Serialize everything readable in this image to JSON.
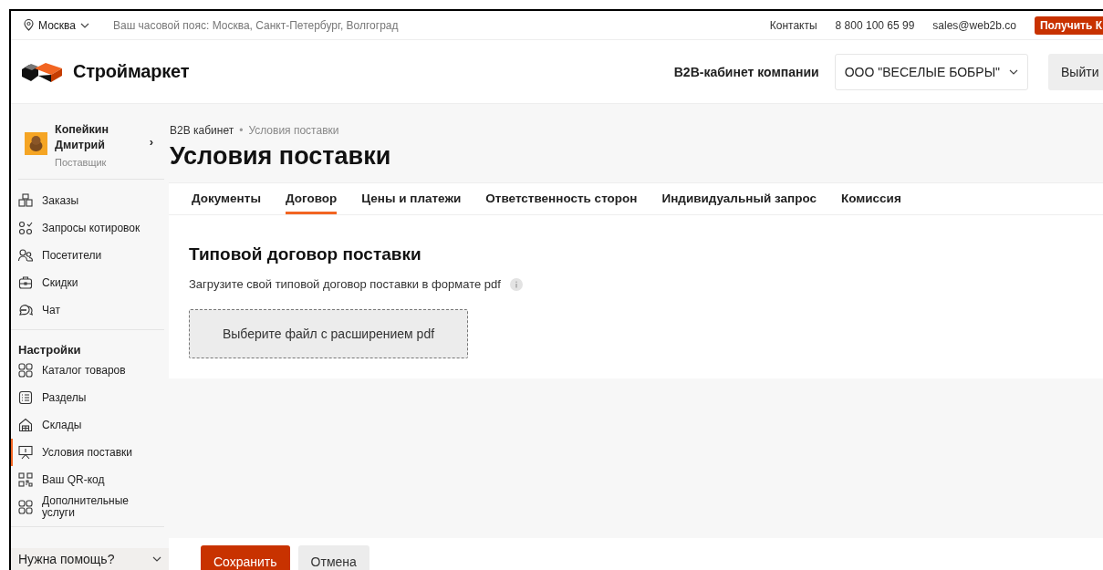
{
  "top_bar": {
    "city": "Москва",
    "timezone": "Ваш часовой пояс: Москва, Санкт-Петербург, Волгоград",
    "links": [
      "Контакты",
      "8 800 100 65 99",
      "sales@web2b.co"
    ],
    "cta": "Получить К"
  },
  "header": {
    "logo": "Строймаркет",
    "cabinet_label": "B2B-кабинет компании",
    "company": "ООО \"ВЕСЕЛЫЕ БОБРЫ\"",
    "logout": "Выйти"
  },
  "user": {
    "name": "Копейкин Дмитрий",
    "role": "Поставщик",
    "arrow": "›"
  },
  "sidebar": {
    "groups": [
      {
        "items": [
          {
            "label": "Заказы",
            "selected": false
          },
          {
            "label": "Запросы котировок",
            "selected": false
          },
          {
            "label": "Посетители",
            "selected": false
          },
          {
            "label": "Скидки",
            "selected": false
          },
          {
            "label": "Чат",
            "selected": false
          }
        ]
      },
      {
        "title": "Настройки",
        "items": [
          {
            "label": "Каталог товаров",
            "selected": false
          },
          {
            "label": "Разделы",
            "selected": false
          },
          {
            "label": "Склады",
            "selected": false
          },
          {
            "label": "Условия поставки",
            "selected": true
          },
          {
            "label": "Ваш QR-код",
            "selected": false
          },
          {
            "label": "Дополнительные услуги",
            "selected": false
          }
        ]
      }
    ],
    "help": "Нужна помощь?"
  },
  "breadcrumb": [
    "B2B кабинет",
    "Условия поставки"
  ],
  "breadcrumb_separator": "•",
  "title": "Условия поставки",
  "tabs": [
    {
      "label": "Документы",
      "selected": false
    },
    {
      "label": "Договор",
      "selected": true
    },
    {
      "label": "Цены и платежи",
      "selected": false
    },
    {
      "label": "Ответственность сторон",
      "selected": false
    },
    {
      "label": "Индивидуальный запрос",
      "selected": false
    },
    {
      "label": "Комиссия",
      "selected": false
    }
  ],
  "section": {
    "heading": "Типовой договор поставки",
    "hint": "Загрузите свой типовой договор поставки в формате pdf",
    "upload_button": "Выберите файл с расширением pdf"
  },
  "footer": {
    "buttons": [
      {
        "label": "Сохранить",
        "kind": "primary"
      },
      {
        "label": "Отмена",
        "kind": "secondary"
      }
    ]
  }
}
